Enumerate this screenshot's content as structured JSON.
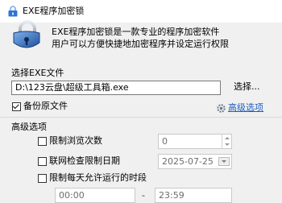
{
  "window": {
    "title": "EXE程序加密锁",
    "icon": "lock-icon",
    "accent": "#1f5fbf"
  },
  "header": {
    "icon": "padlock-icon",
    "line1": "EXE程序加密锁是一款专业的程序加密软件",
    "line2": "用户可以方便快捷地加密程序并设定运行权限"
  },
  "file": {
    "section_label": "选择EXE文件",
    "path": "D:\\123云盘\\超级工具箱.exe",
    "browse_label": "选择...",
    "backup_label": "备份原文件",
    "backup_checked": true,
    "advanced_link": "高级选项",
    "advanced_link_icon": "settings-icon"
  },
  "advanced": {
    "section_label": "高级选项",
    "limit_count_label": "限制浏览次数",
    "limit_count_checked": false,
    "limit_count_value": "0",
    "limit_date_label": "联网检查限制日期",
    "limit_date_checked": false,
    "limit_date_value": "2025-07-25",
    "limit_time_label": "限制每天允许运行的时段",
    "limit_time_checked": false,
    "time_start": "00:00",
    "time_sep": "-",
    "time_end": "23:59"
  }
}
